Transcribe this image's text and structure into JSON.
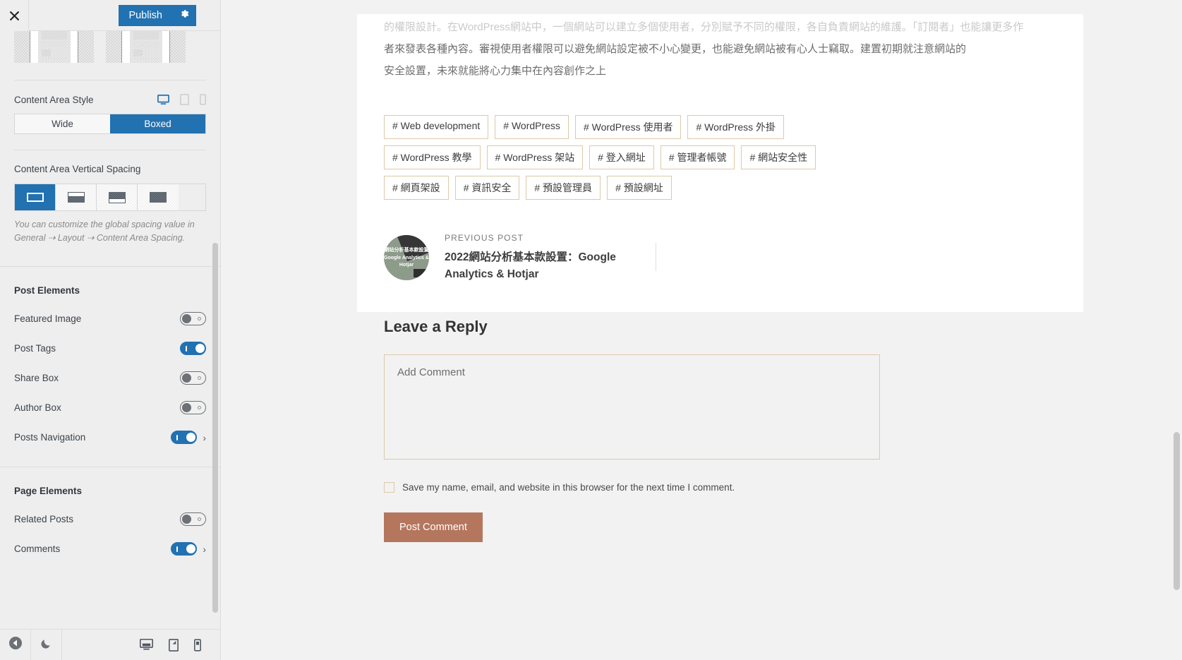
{
  "sidebar": {
    "close_icon": "close-icon",
    "publish_label": "Publish",
    "gear_icon": "gear-icon",
    "content_area_style": {
      "label": "Content Area Style",
      "devices": [
        "desktop-icon",
        "tablet-icon",
        "mobile-icon"
      ],
      "active_device": "desktop-icon",
      "options": [
        {
          "label": "Wide",
          "active": false
        },
        {
          "label": "Boxed",
          "active": true
        }
      ]
    },
    "vertical_spacing": {
      "label": "Content Area Vertical Spacing",
      "options": [
        {
          "name": "spacing-both",
          "active": true
        },
        {
          "name": "spacing-top",
          "active": false
        },
        {
          "name": "spacing-bottom",
          "active": false
        },
        {
          "name": "spacing-none",
          "active": false
        }
      ],
      "help_text": "You can customize the global spacing value in General ⇢ Layout ⇢ Content Area Spacing."
    },
    "post_elements": {
      "title": "Post Elements",
      "items": [
        {
          "label": "Featured Image",
          "on": false,
          "chevron": false
        },
        {
          "label": "Post Tags",
          "on": true,
          "chevron": false
        },
        {
          "label": "Share Box",
          "on": false,
          "chevron": false
        },
        {
          "label": "Author Box",
          "on": false,
          "chevron": false
        },
        {
          "label": "Posts Navigation",
          "on": true,
          "chevron": true
        }
      ]
    },
    "page_elements": {
      "title": "Page Elements",
      "items": [
        {
          "label": "Related Posts",
          "on": false,
          "chevron": false
        },
        {
          "label": "Comments",
          "on": true,
          "chevron": true
        }
      ]
    },
    "footer": {
      "back_icon": "back-arrow-icon",
      "dark_mode_icon": "moon-icon",
      "previews": [
        "desktop-preview-icon",
        "tablet-preview-icon",
        "mobile-preview-icon"
      ]
    }
  },
  "preview": {
    "paragraph_lines": [
      "者來發表各種內容。審視使用者權限可以避免網站設定被不小心變更，也能避免網站被有心人士竊取。建置初期就注意網站的",
      "安全設置，未來就能將心力集中在內容創作之上"
    ],
    "faded_line": "的權限設計。在WordPress網站中，一個網站可以建立多個使用者，分別賦予不同的權限，各自負責網站的維護。「訂閱者」也能讓更多作",
    "tags": [
      "# Web development",
      "# WordPress",
      "# WordPress 使用者",
      "# WordPress 外掛",
      "# WordPress 教學",
      "# WordPress 架站",
      "# 登入網址",
      "# 管理者帳號",
      "# 網站安全性",
      "# 網頁架設",
      "# 資訊安全",
      "# 預設管理員",
      "# 預設網址"
    ],
    "previous_post": {
      "kicker": "PREVIOUS POST",
      "title": "2022網站分析基本款設置：Google Analytics & Hotjar",
      "thumb_text": "網站分析基本款設置 Google Analytics & Hotjar"
    },
    "comments": {
      "heading": "Leave a Reply",
      "textarea_placeholder": "Add Comment",
      "save_label": "Save my name, email, and website in this browser for the next time I comment.",
      "submit_label": "Post Comment"
    }
  },
  "colors": {
    "accent": "#2271b1",
    "button": "#b5765e",
    "tag_border": "#ddc9ab"
  }
}
